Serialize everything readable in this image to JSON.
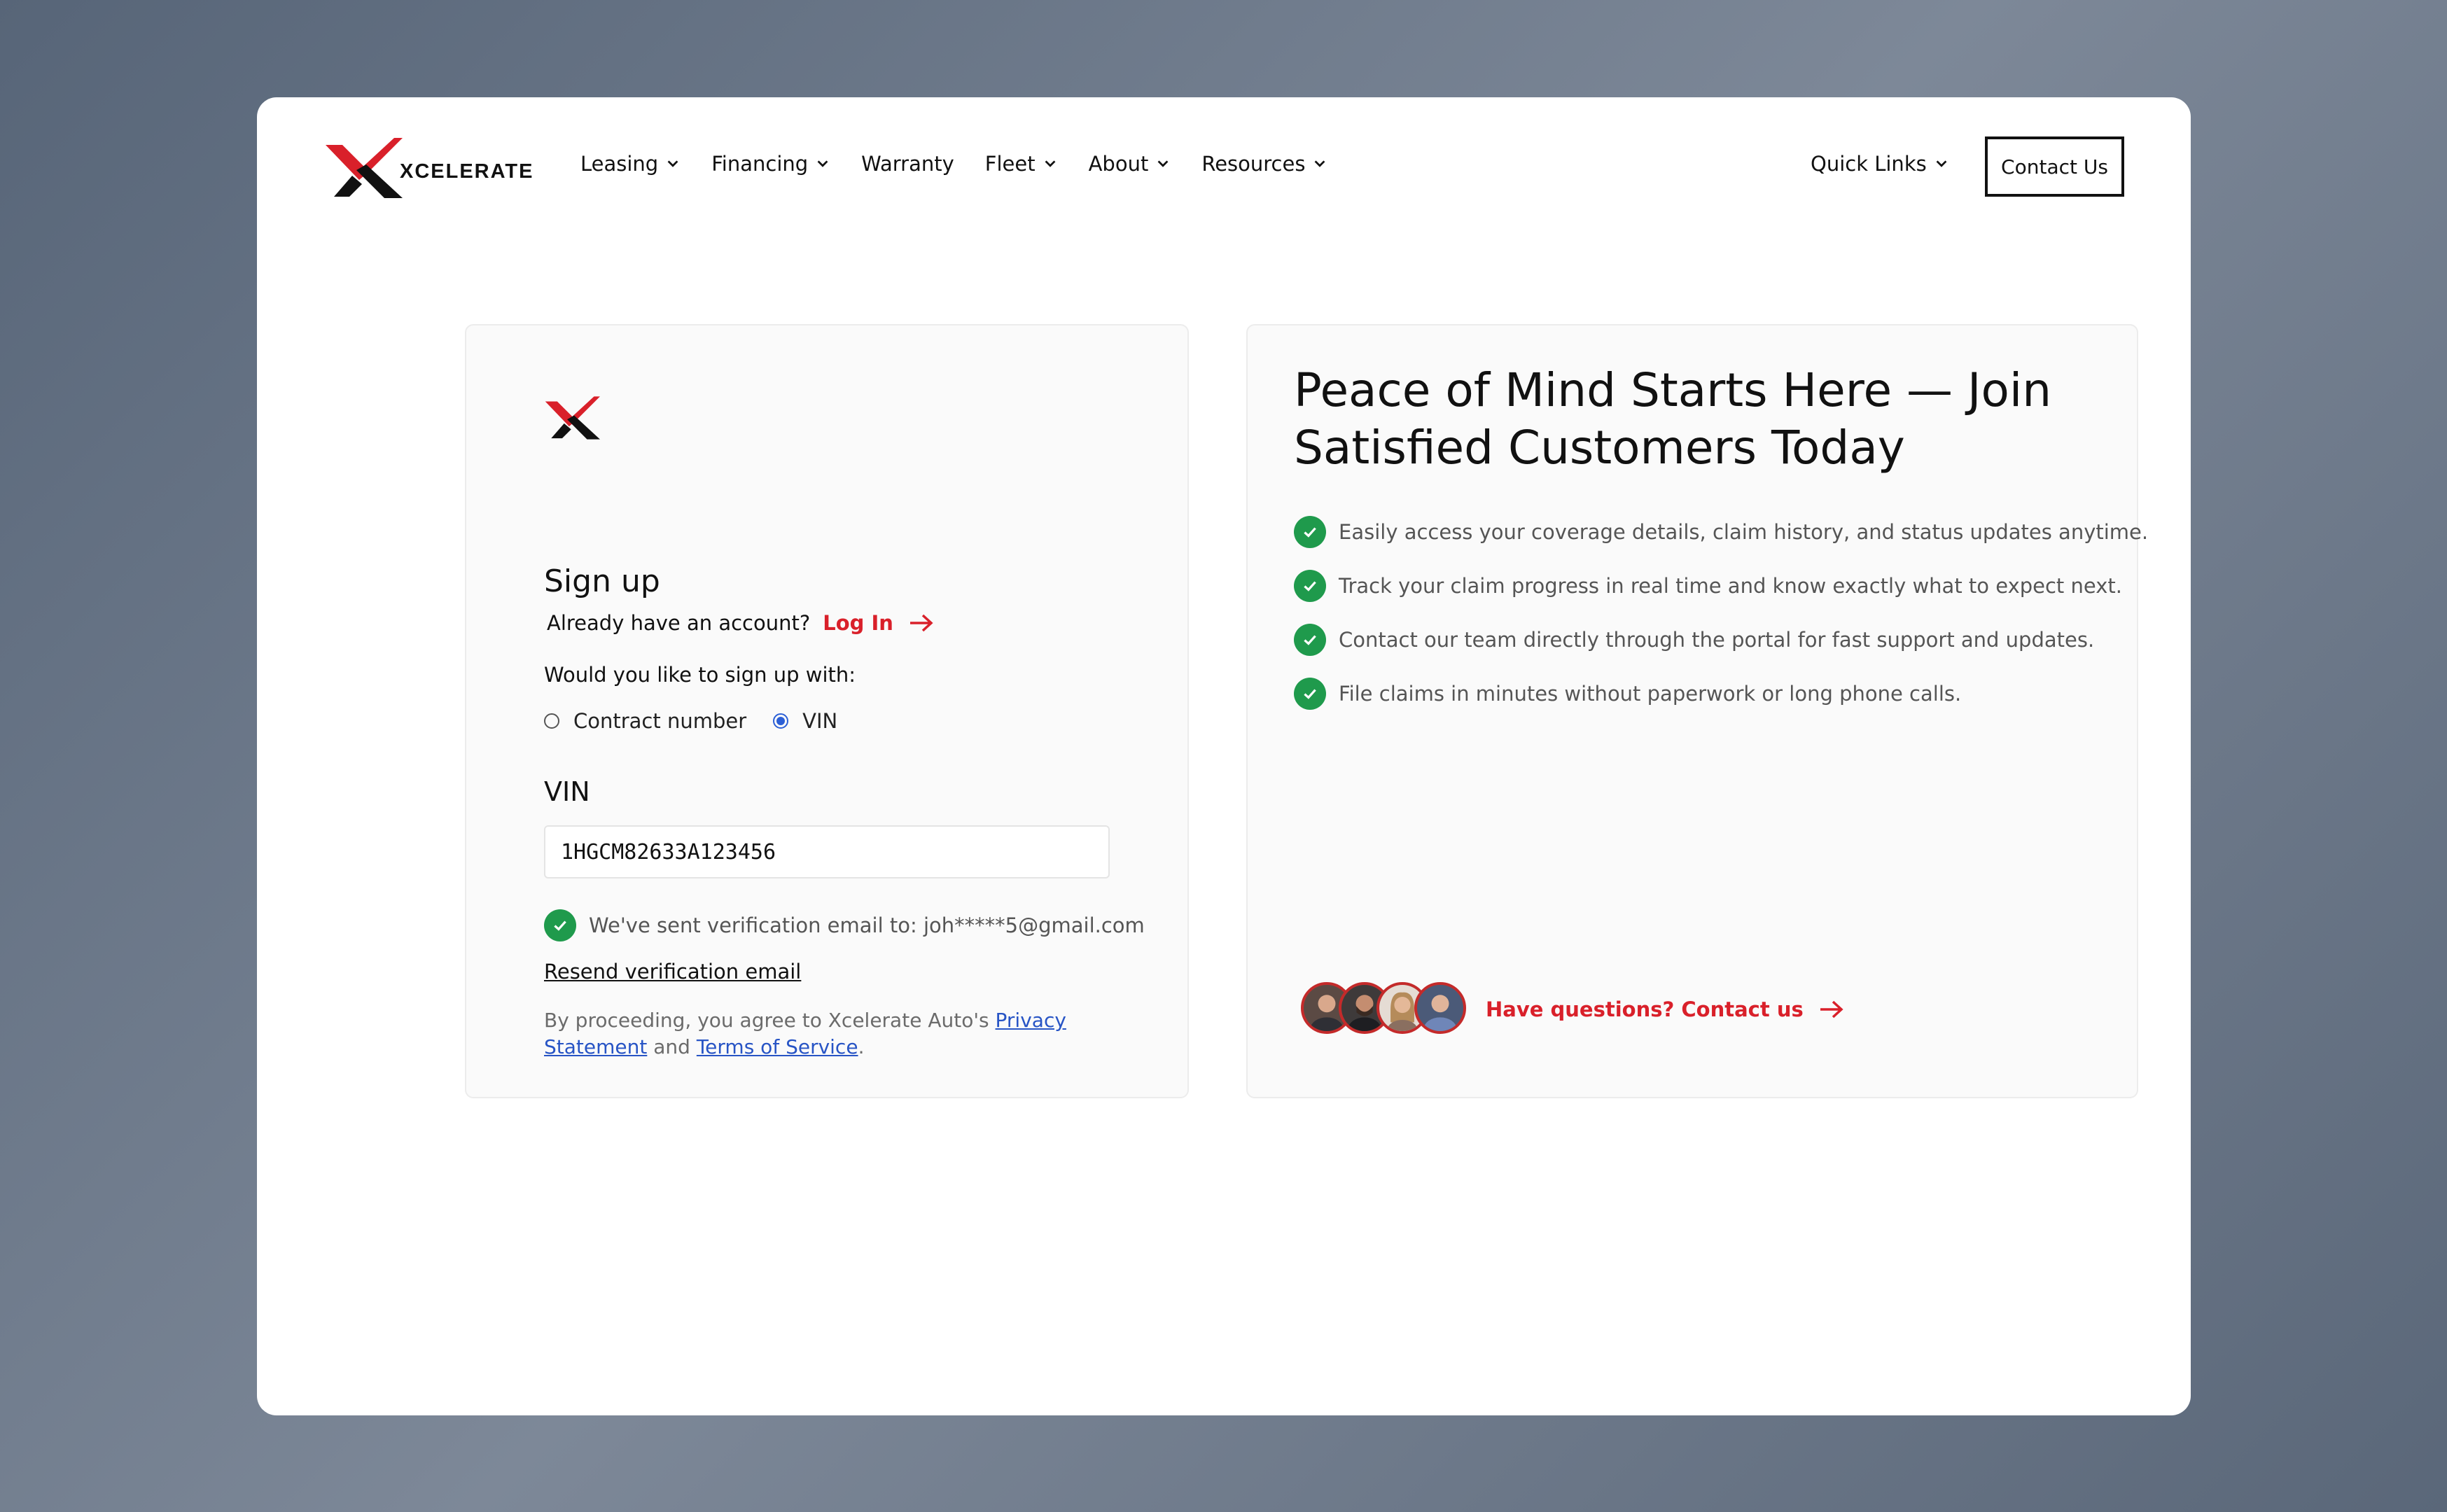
{
  "nav": {
    "brand": "XCELERATE",
    "menu": [
      {
        "label": "Leasing",
        "dropdown": true
      },
      {
        "label": "Financing",
        "dropdown": true
      },
      {
        "label": "Warranty",
        "dropdown": false
      },
      {
        "label": "Fleet",
        "dropdown": true
      },
      {
        "label": "About",
        "dropdown": true
      },
      {
        "label": "Resources",
        "dropdown": true
      }
    ],
    "quick_links": "Quick Links",
    "contact_button": "Contact Us"
  },
  "signup": {
    "title": "Sign up",
    "already_prompt": "Already have an account?",
    "login_link": "Log In",
    "question": "Would you like to sign up with:",
    "options": [
      {
        "label": "Contract number",
        "selected": false
      },
      {
        "label": "VIN",
        "selected": true
      }
    ],
    "vin_label": "VIN",
    "vin_value": "1HGCM82633A123456",
    "verification_text": "We've sent verification email to: joh*****5@gmail.com",
    "resend_link": "Resend verification email",
    "legal_prefix": "By proceeding, you agree to Xcelerate Auto's ",
    "privacy_link": "Privacy Statement",
    "legal_and": " and ",
    "terms_link": "Terms of Service",
    "legal_suffix": "."
  },
  "promo": {
    "headline": "Peace of Mind Starts Here — Join Satisfied Customers Today",
    "benefits": [
      "Easily access your coverage details, claim history, and status updates anytime.",
      "Track your claim progress in real time and know exactly what to expect next.",
      "Contact our team directly through the portal for fast support and updates.",
      "File claims in minutes without paperwork or long phone calls."
    ],
    "questions_link": "Have questions? Contact us"
  },
  "colors": {
    "accent_red": "#d9202a",
    "success_green": "#1f9a4c",
    "link_blue": "#2754c5"
  }
}
